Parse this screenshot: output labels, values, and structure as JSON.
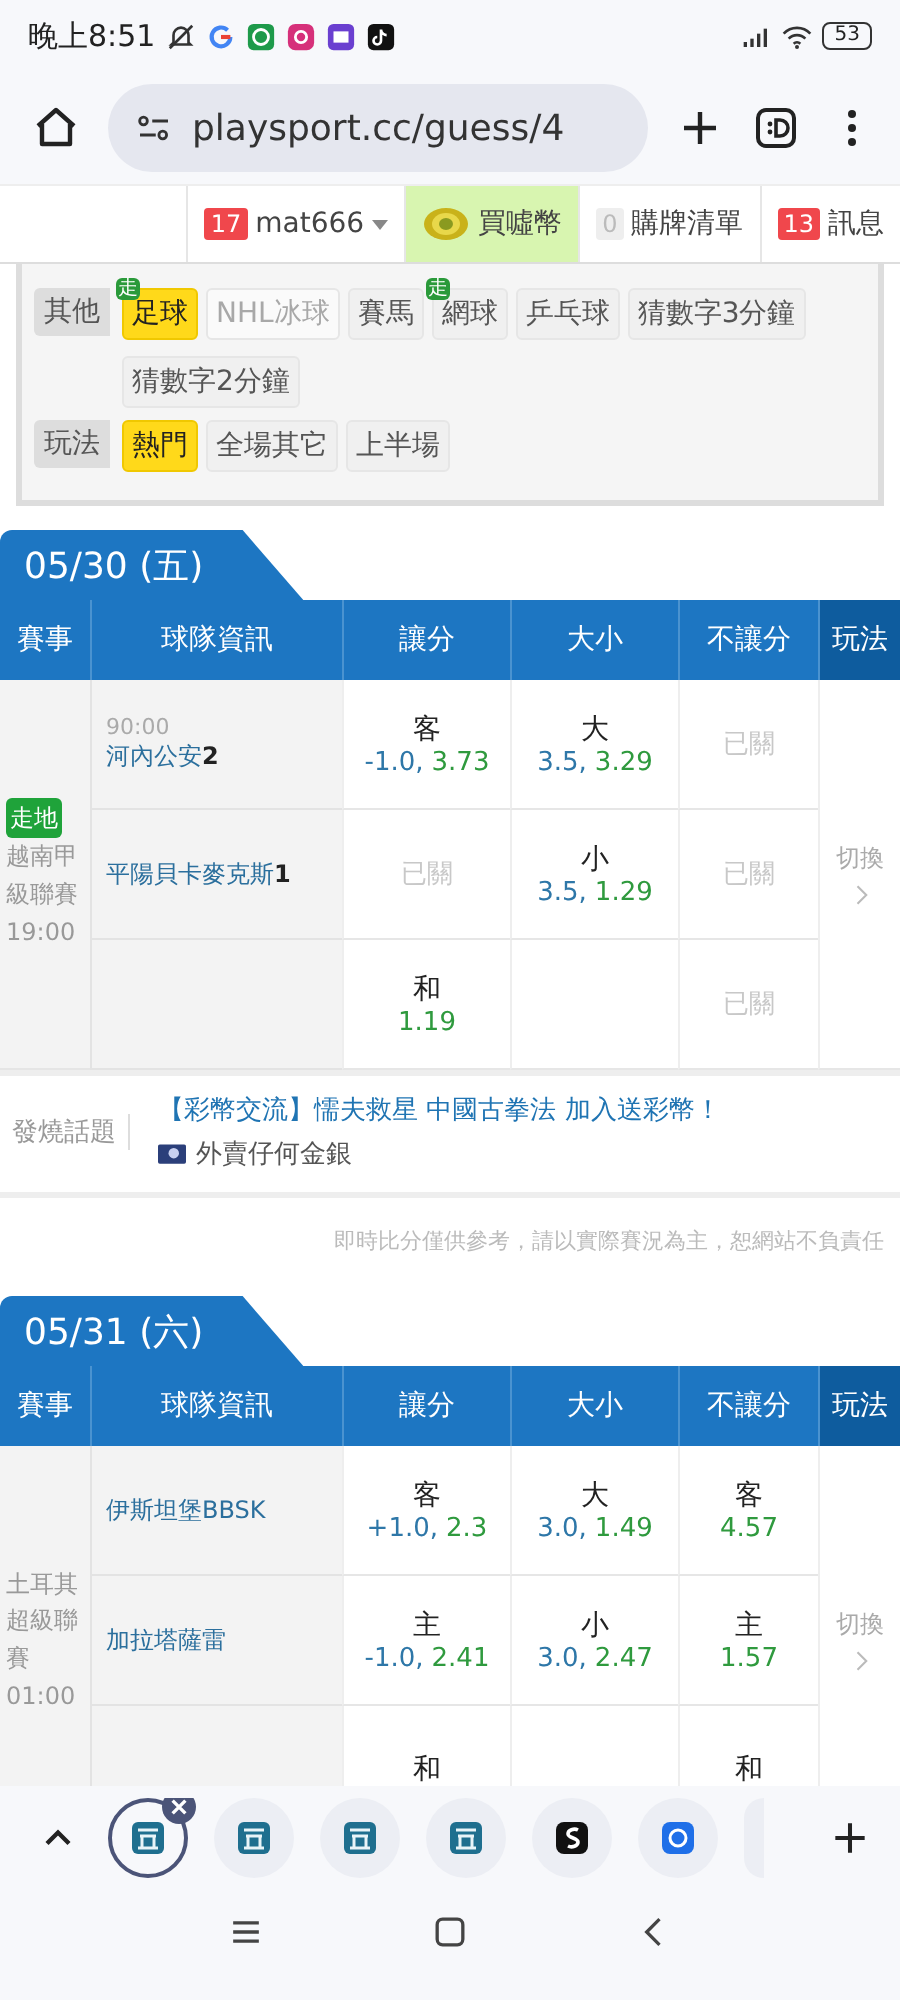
{
  "status_bar": {
    "time": "晚上8:51",
    "battery": "53"
  },
  "browser": {
    "url": "playsport.cc/guess/4"
  },
  "site_nav": {
    "user": {
      "badge": "17",
      "name": "mat666"
    },
    "buy": {
      "label": "買噓幣"
    },
    "cart": {
      "count": "0",
      "label": "購牌清單"
    },
    "messages": {
      "count": "13",
      "label": "訊息"
    }
  },
  "filters": [
    {
      "label": "其他",
      "chips": [
        {
          "text": "足球",
          "selected": true,
          "disabled": false,
          "badge": "走"
        },
        {
          "text": "NHL冰球",
          "selected": false,
          "disabled": true
        },
        {
          "text": "賽馬",
          "selected": false,
          "disabled": false
        },
        {
          "text": "網球",
          "selected": false,
          "disabled": false,
          "badge": "走"
        },
        {
          "text": "乒乓球",
          "selected": false,
          "disabled": false
        },
        {
          "text": "猜數字3分鐘",
          "selected": false,
          "disabled": false
        },
        {
          "text": "猜數字2分鐘",
          "selected": false,
          "disabled": false
        }
      ]
    },
    {
      "label": "玩法",
      "chips": [
        {
          "text": "熱門",
          "selected": true,
          "disabled": false
        },
        {
          "text": "全場其它",
          "selected": false,
          "disabled": false
        },
        {
          "text": "上半場",
          "selected": false,
          "disabled": false
        }
      ]
    }
  ],
  "days": [
    {
      "date": "05/30 (五)",
      "columns": [
        "賽事",
        "球隊資訊",
        "讓分",
        "大小",
        "不讓分",
        "玩法"
      ],
      "game": {
        "live_tag": "走地",
        "league": "越南甲級聯賽",
        "time": "19:00",
        "switch": "切換",
        "rows": [
          {
            "clock": "90:00",
            "team": "河內公安",
            "score": "2",
            "cells": [
              {
                "kind": "odds",
                "side": "客",
                "line": "-1.0,",
                "price": "3.73"
              },
              {
                "kind": "odds",
                "side": "大",
                "line": "3.5,",
                "price": "3.29"
              },
              {
                "kind": "closed",
                "text": "已關"
              }
            ]
          },
          {
            "team": "平陽貝卡麥克斯",
            "score": "1",
            "cells": [
              {
                "kind": "closed",
                "text": "已關"
              },
              {
                "kind": "odds",
                "side": "小",
                "line": "3.5,",
                "price": "1.29"
              },
              {
                "kind": "closed",
                "text": "已關"
              }
            ]
          },
          {
            "cells": [
              {
                "kind": "odds",
                "side": "和",
                "price": "1.19"
              },
              {
                "kind": "empty"
              },
              {
                "kind": "closed",
                "text": "已關"
              }
            ]
          }
        ]
      }
    },
    {
      "date": "05/31 (六)",
      "columns": [
        "賽事",
        "球隊資訊",
        "讓分",
        "大小",
        "不讓分",
        "玩法"
      ],
      "game": {
        "league": "土耳其超級聯賽",
        "time": "01:00",
        "switch": "切換",
        "rows": [
          {
            "team": "伊斯坦堡BBSK",
            "cells": [
              {
                "kind": "odds",
                "side": "客",
                "line": "+1.0,",
                "price": "2.3"
              },
              {
                "kind": "odds",
                "side": "大",
                "line": "3.0,",
                "price": "1.49"
              },
              {
                "kind": "odds",
                "side": "客",
                "price": "4.57"
              }
            ]
          },
          {
            "team": "加拉塔薩雷",
            "cells": [
              {
                "kind": "odds",
                "side": "主",
                "line": "-1.0,",
                "price": "2.41"
              },
              {
                "kind": "odds",
                "side": "小",
                "line": "3.0,",
                "price": "2.47"
              },
              {
                "kind": "odds",
                "side": "主",
                "price": "1.57"
              }
            ]
          },
          {
            "cells": [
              {
                "kind": "odds",
                "side": "和"
              },
              {
                "kind": "empty"
              },
              {
                "kind": "odds",
                "side": "和"
              }
            ]
          }
        ]
      }
    }
  ],
  "hot_topic": {
    "label": "發燒話題",
    "title": "【彩幣交流】懦夫救星 中國古拳法 加入送彩幣！",
    "author": "外賣仔何金銀"
  },
  "disclaimer": "即時比分僅供參考，請以實際賽況為主，恕網站不負責任",
  "tab_strip": [
    {
      "kind": "wan",
      "selected": true
    },
    {
      "kind": "wan",
      "selected": false
    },
    {
      "kind": "wan",
      "selected": false
    },
    {
      "kind": "wan",
      "selected": false
    },
    {
      "kind": "script",
      "selected": false
    },
    {
      "kind": "chat",
      "selected": false
    },
    {
      "kind": "partial",
      "selected": false
    }
  ]
}
